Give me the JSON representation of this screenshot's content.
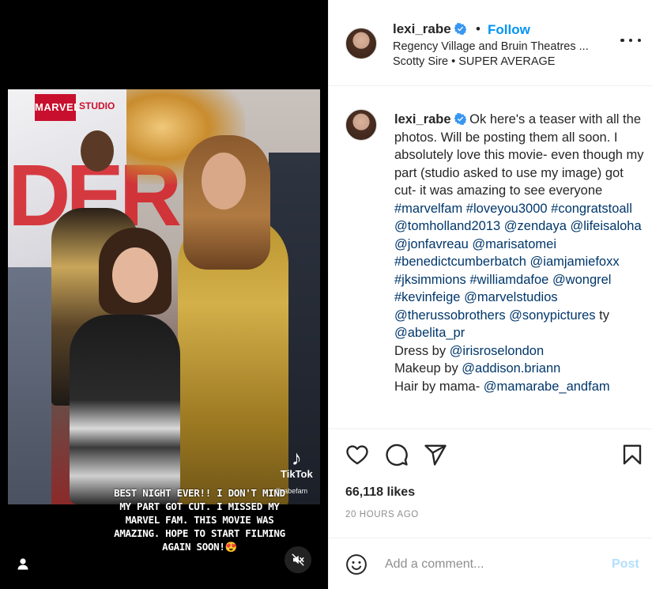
{
  "post": {
    "author": {
      "username": "lexi_rabe",
      "verified": true,
      "follow_label": "Follow",
      "location": "Regency Village and Bruin Theatres ...",
      "audio_artist": "Scotty Sire",
      "audio_separator": "•",
      "audio_title": "SUPER AVERAGE",
      "header_dot": "•"
    },
    "media": {
      "overlay_caption": "BEST NIGHT EVER!! I DON'T MIND MY PART GOT CUT. I MISSED MY MARVEL FAM. THIS MOVIE WAS AMAZING. HOPE TO START FILMING AGAIN SOON!😍",
      "watermark_name": "TikTok",
      "watermark_handle": "@rabefam",
      "backdrop_brand": "MARVEL",
      "backdrop_brand_suffix": "STUDIO",
      "backdrop_title": "DER"
    },
    "caption": {
      "username": "lexi_rabe",
      "body": [
        {
          "t": "text",
          "v": "Ok here's a teaser with all the photos. Will be posting them all soon. I absolutely love this movie- even though my part (studio asked to use my image) got cut- it was amazing to see everyone "
        },
        {
          "t": "link",
          "v": "#marvelfam"
        },
        {
          "t": "text",
          "v": " "
        },
        {
          "t": "link",
          "v": "#loveyou3000"
        },
        {
          "t": "text",
          "v": " "
        },
        {
          "t": "link",
          "v": "#congratstoall"
        },
        {
          "t": "text",
          "v": " "
        },
        {
          "t": "link",
          "v": "@tomholland2013"
        },
        {
          "t": "text",
          "v": " "
        },
        {
          "t": "link",
          "v": "@zendaya"
        },
        {
          "t": "text",
          "v": " "
        },
        {
          "t": "link",
          "v": "@lifeisaloha"
        },
        {
          "t": "text",
          "v": " "
        },
        {
          "t": "link",
          "v": "@jonfavreau"
        },
        {
          "t": "text",
          "v": " "
        },
        {
          "t": "link",
          "v": "@marisatomei"
        },
        {
          "t": "text",
          "v": " "
        },
        {
          "t": "link",
          "v": "#benedictcumberbatch"
        },
        {
          "t": "text",
          "v": " "
        },
        {
          "t": "link",
          "v": "@iamjamiefoxx"
        },
        {
          "t": "text",
          "v": " "
        },
        {
          "t": "link",
          "v": "#jksimmions"
        },
        {
          "t": "text",
          "v": " "
        },
        {
          "t": "link",
          "v": "#williamdafoe"
        },
        {
          "t": "text",
          "v": " "
        },
        {
          "t": "link",
          "v": "@wongrel"
        },
        {
          "t": "text",
          "v": " "
        },
        {
          "t": "link",
          "v": "#kevinfeige"
        },
        {
          "t": "text",
          "v": " "
        },
        {
          "t": "link",
          "v": "@marvelstudios"
        },
        {
          "t": "text",
          "v": " "
        },
        {
          "t": "link",
          "v": "@therussobrothers"
        },
        {
          "t": "text",
          "v": " "
        },
        {
          "t": "link",
          "v": "@sonypictures"
        },
        {
          "t": "text",
          "v": " ty "
        },
        {
          "t": "link",
          "v": "@abelita_pr"
        },
        {
          "t": "br"
        },
        {
          "t": "text",
          "v": "Dress by "
        },
        {
          "t": "link",
          "v": "@irisroselondon"
        },
        {
          "t": "br"
        },
        {
          "t": "text",
          "v": "Makeup by "
        },
        {
          "t": "link",
          "v": "@addison.briann"
        },
        {
          "t": "br"
        },
        {
          "t": "text",
          "v": "Hair by mama- "
        },
        {
          "t": "link",
          "v": "@mamarabe_andfam"
        }
      ]
    },
    "stats": {
      "likes": "66,118 likes",
      "time": "20 HOURS AGO"
    },
    "comment_box": {
      "placeholder": "Add a comment...",
      "post_label": "Post"
    },
    "icons": {
      "like": "heart-icon",
      "comment": "comment-icon",
      "share": "share-icon",
      "save": "bookmark-icon",
      "emoji": "emoji-icon",
      "more": "more-options-icon",
      "mute": "muted-speaker-icon",
      "tag": "user-tag-icon",
      "verified": "verified-badge-icon"
    },
    "colors": {
      "link": "#00376b",
      "follow": "#0095f6",
      "post_disabled": "#b2dffc",
      "muted_text": "#8e8e8e"
    }
  }
}
